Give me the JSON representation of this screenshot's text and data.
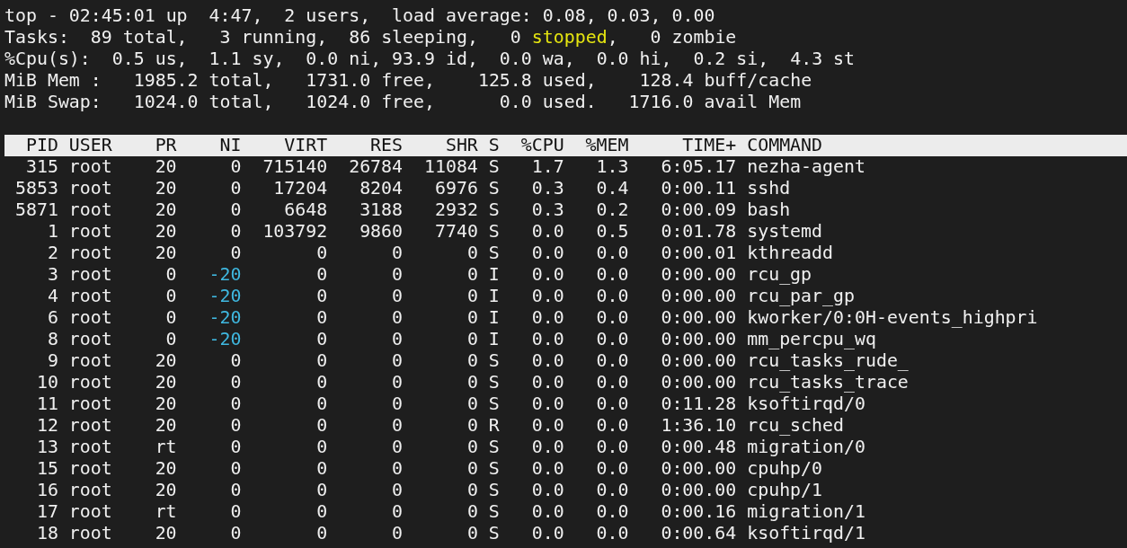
{
  "summary": [
    {
      "segments": [
        {
          "text": "top - 02:45:01 up  4:47,  2 users,  load average: 0.08, 0.03, 0.00"
        }
      ]
    },
    {
      "segments": [
        {
          "text": "Tasks:  89 total,   3 running,  86 sleeping,   0 "
        },
        {
          "text": "stopped",
          "color": "#e5e510"
        },
        {
          "text": ",   0 zombie"
        }
      ]
    },
    {
      "segments": [
        {
          "text": "%Cpu(s):  0.5 us,  1.1 sy,  0.0 ni, 93.9 id,  0.0 wa,  0.0 hi,  0.2 si,  4.3 st"
        }
      ]
    },
    {
      "segments": [
        {
          "text": "MiB Mem :   1985.2 total,   1731.0 free,    125.8 used,    128.4 buff/cache"
        }
      ]
    },
    {
      "segments": [
        {
          "text": "MiB Swap:   1024.0 total,   1024.0 free,      0.0 used.   1716.0 avail Mem"
        }
      ]
    }
  ],
  "table": {
    "columns": [
      "PID",
      "USER",
      "PR",
      "NI",
      "VIRT",
      "RES",
      "SHR",
      "S",
      "%CPU",
      "%MEM",
      "TIME+",
      "COMMAND"
    ],
    "rows": [
      {
        "cells": [
          "315",
          "root",
          "20",
          "0",
          "715140",
          "26784",
          "11084",
          "S",
          "1.7",
          "1.3",
          "6:05.17",
          "nezha-agent"
        ]
      },
      {
        "cells": [
          "5853",
          "root",
          "20",
          "0",
          "17204",
          "8204",
          "6976",
          "S",
          "0.3",
          "0.4",
          "0:00.11",
          "sshd"
        ]
      },
      {
        "cells": [
          "5871",
          "root",
          "20",
          "0",
          "6648",
          "3188",
          "2932",
          "S",
          "0.3",
          "0.2",
          "0:00.09",
          "bash"
        ]
      },
      {
        "cells": [
          "1",
          "root",
          "20",
          "0",
          "103792",
          "9860",
          "7740",
          "S",
          "0.0",
          "0.5",
          "0:01.78",
          "systemd"
        ]
      },
      {
        "cells": [
          "2",
          "root",
          "20",
          "0",
          "0",
          "0",
          "0",
          "S",
          "0.0",
          "0.0",
          "0:00.01",
          "kthreadd"
        ]
      },
      {
        "cells": [
          "3",
          "root",
          "0",
          {
            "text": "-20",
            "color": "#3fb8e0"
          },
          "0",
          "0",
          "0",
          "I",
          "0.0",
          "0.0",
          "0:00.00",
          "rcu_gp"
        ]
      },
      {
        "cells": [
          "4",
          "root",
          "0",
          {
            "text": "-20",
            "color": "#3fb8e0"
          },
          "0",
          "0",
          "0",
          "I",
          "0.0",
          "0.0",
          "0:00.00",
          "rcu_par_gp"
        ]
      },
      {
        "cells": [
          "6",
          "root",
          "0",
          {
            "text": "-20",
            "color": "#3fb8e0"
          },
          "0",
          "0",
          "0",
          "I",
          "0.0",
          "0.0",
          "0:00.00",
          "kworker/0:0H-events_highpri"
        ]
      },
      {
        "cells": [
          "8",
          "root",
          "0",
          {
            "text": "-20",
            "color": "#3fb8e0"
          },
          "0",
          "0",
          "0",
          "I",
          "0.0",
          "0.0",
          "0:00.00",
          "mm_percpu_wq"
        ]
      },
      {
        "cells": [
          "9",
          "root",
          "20",
          "0",
          "0",
          "0",
          "0",
          "S",
          "0.0",
          "0.0",
          "0:00.00",
          "rcu_tasks_rude_"
        ]
      },
      {
        "cells": [
          "10",
          "root",
          "20",
          "0",
          "0",
          "0",
          "0",
          "S",
          "0.0",
          "0.0",
          "0:00.00",
          "rcu_tasks_trace"
        ]
      },
      {
        "cells": [
          "11",
          "root",
          "20",
          "0",
          "0",
          "0",
          "0",
          "S",
          "0.0",
          "0.0",
          "0:11.28",
          "ksoftirqd/0"
        ]
      },
      {
        "cells": [
          "12",
          "root",
          "20",
          "0",
          "0",
          "0",
          "0",
          "R",
          "0.0",
          "0.0",
          "1:36.10",
          "rcu_sched"
        ]
      },
      {
        "cells": [
          "13",
          "root",
          "rt",
          "0",
          "0",
          "0",
          "0",
          "S",
          "0.0",
          "0.0",
          "0:00.48",
          "migration/0"
        ]
      },
      {
        "cells": [
          "15",
          "root",
          "20",
          "0",
          "0",
          "0",
          "0",
          "S",
          "0.0",
          "0.0",
          "0:00.00",
          "cpuhp/0"
        ]
      },
      {
        "cells": [
          "16",
          "root",
          "20",
          "0",
          "0",
          "0",
          "0",
          "S",
          "0.0",
          "0.0",
          "0:00.00",
          "cpuhp/1"
        ]
      },
      {
        "cells": [
          "17",
          "root",
          "rt",
          "0",
          "0",
          "0",
          "0",
          "S",
          "0.0",
          "0.0",
          "0:00.16",
          "migration/1"
        ]
      },
      {
        "cells": [
          "18",
          "root",
          "20",
          "0",
          "0",
          "0",
          "0",
          "S",
          "0.0",
          "0.0",
          "0:00.64",
          "ksoftirqd/1"
        ]
      }
    ]
  }
}
